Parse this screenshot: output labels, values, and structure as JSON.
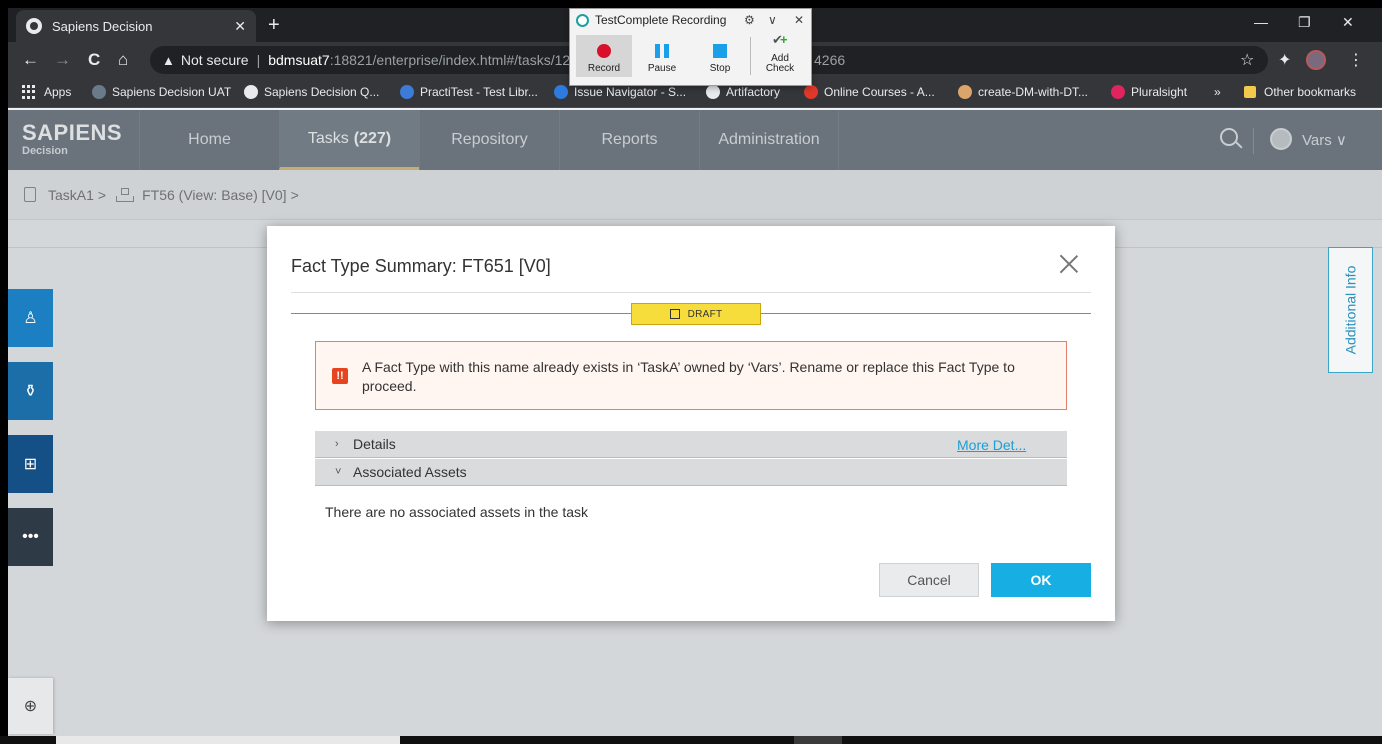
{
  "browser": {
    "tab_title": "Sapiens Decision",
    "tab_close": "✕",
    "new_tab": "+",
    "window_controls": [
      "—",
      "❐",
      "✕"
    ],
    "nav": {
      "back": "←",
      "forward": "→",
      "reload": "C",
      "home": "⌂"
    },
    "url": {
      "security": "Not secure",
      "host": "bdmsuat7",
      "path": ":18821/enterprise/index.html#/tasks/12",
      "tail": "4266"
    },
    "toolbar_icons": {
      "star": "☆",
      "extensions": "✦",
      "menu": "⋮"
    },
    "bookmarks": [
      {
        "label": "Apps",
        "color": "#e8eaed"
      },
      {
        "label": "Sapiens Decision UAT",
        "color": "#6b7a89"
      },
      {
        "label": "Sapiens Decision Q...",
        "color": "#e8eaed"
      },
      {
        "label": "PractiTest - Test Libr...",
        "color": "#3c7bd8"
      },
      {
        "label": "Issue Navigator - S...",
        "color": "#2d7ae0"
      },
      {
        "label": "Artifactory",
        "color": "#e8eaed"
      },
      {
        "label": "Online Courses - A...",
        "color": "#e0382a"
      },
      {
        "label": "create-DM-with-DT...",
        "color": "#d9a56b"
      },
      {
        "label": "Pluralsight",
        "color": "#e0245e"
      }
    ],
    "more_bookmarks": "»",
    "other_bookmarks": "Other bookmarks"
  },
  "app": {
    "logo_main": "SAPIENS",
    "logo_sub": "Decision",
    "nav": [
      {
        "label": "Home"
      },
      {
        "label": "Tasks",
        "count": "(227)"
      },
      {
        "label": "Repository"
      },
      {
        "label": "Reports"
      },
      {
        "label": "Administration"
      }
    ],
    "user": "Vars",
    "user_chevron": "∨"
  },
  "breadcrumb": {
    "task": "TaskA1",
    "sep": ">",
    "item": "FT56 (View: Base) [V0]"
  },
  "side_buttons": [
    "♙",
    "⚱",
    "⊞",
    "•••"
  ],
  "zoom_icon": "⊕",
  "additional_info": "Additional Info",
  "modal": {
    "title": "Fact Type Summary: FT651 [V0]",
    "status": "DRAFT",
    "error_icon": "!!",
    "error_text": "A Fact Type with this name already exists in ‘TaskA’ owned by ‘Vars’. Rename or replace this Fact Type to proceed.",
    "sections": [
      {
        "label": "Details",
        "chevron": "›"
      },
      {
        "label": "Associated Assets",
        "chevron": "˅"
      }
    ],
    "more_details": "More Det...",
    "no_assets": "There are no associated assets in the task",
    "cancel": "Cancel",
    "ok": "OK"
  },
  "testcomplete": {
    "title": "TestComplete Recording",
    "controls": [
      "⚙",
      "∨",
      "✕"
    ],
    "record": "Record",
    "pause": "Pause",
    "stop": "Stop",
    "add_check_1": "Add",
    "add_check_2": "Check"
  }
}
